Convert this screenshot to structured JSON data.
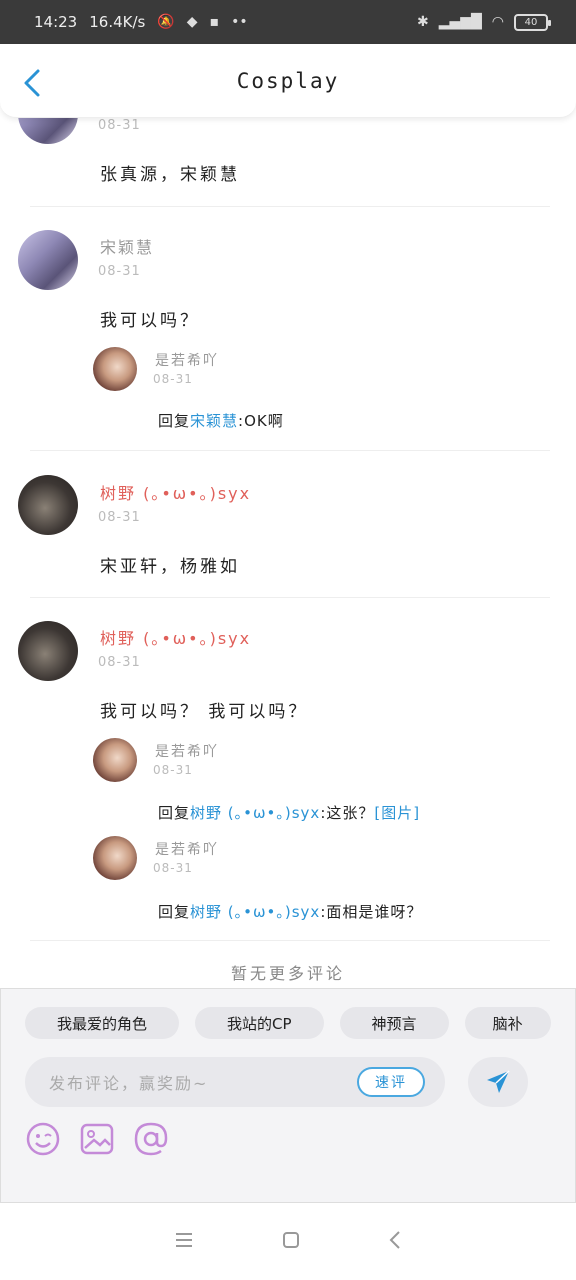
{
  "status_bar": {
    "time": "14:23",
    "speed": "16.4K/s",
    "battery": "40"
  },
  "header": {
    "title": "Cosplay"
  },
  "comments": [
    {
      "date": "08-31",
      "text": "张真源，宋颖慧"
    },
    {
      "name": "宋颖慧",
      "date": "08-31",
      "text": "我可以吗？",
      "replies": [
        {
          "name": "是若希吖",
          "date": "08-31",
          "prefix": "回复",
          "target": "宋颖慧",
          "content": ":OK啊"
        }
      ]
    },
    {
      "name": "树野 (｡•ω•｡)syx",
      "date": "08-31",
      "text": "宋亚轩，杨雅如"
    },
    {
      "name": "树野 (｡•ω•｡)syx",
      "date": "08-31",
      "text": "我可以吗？ 我可以吗？",
      "replies": [
        {
          "name": "是若希吖",
          "date": "08-31",
          "prefix": "回复",
          "target": "树野 (｡•ω•｡)syx",
          "content": ":这张？",
          "link": "[图片]"
        },
        {
          "name": "是若希吖",
          "date": "08-31",
          "prefix": "回复",
          "target": "树野 (｡•ω•｡)syx",
          "content": ":面相是谁呀？"
        }
      ]
    }
  ],
  "no_more": "暂无更多评论",
  "tags": [
    "我最爱的角色",
    "我站的CP",
    "神预言",
    "脑补"
  ],
  "input": {
    "placeholder": "发布评论，赢奖励~",
    "quick_label": "速评"
  },
  "colors": {
    "accent": "#2a93d5",
    "highlight_name": "#e0605a",
    "emoji_icon": "#c48ad8"
  }
}
